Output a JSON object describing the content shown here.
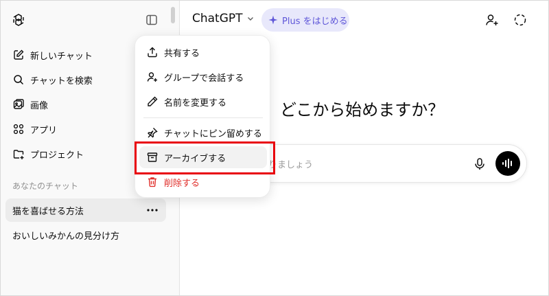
{
  "sidebar": {
    "nav": [
      {
        "label": "新しいチャット",
        "icon": "new-chat-icon"
      },
      {
        "label": "チャットを検索",
        "icon": "search-icon"
      },
      {
        "label": "画像",
        "icon": "images-icon"
      },
      {
        "label": "アプリ",
        "icon": "apps-icon"
      },
      {
        "label": "プロジェクト",
        "icon": "folder-plus-icon"
      }
    ],
    "section_label": "あなたのチャット",
    "chats": [
      {
        "label": "猫を喜ばせる方法",
        "active": true
      },
      {
        "label": "おいしいみかんの見分け方",
        "active": false
      }
    ]
  },
  "header": {
    "model": "ChatGPT",
    "plus_label": "Plus をはじめる",
    "accent": "#5e56d8"
  },
  "main": {
    "heading": "どこから始めますか？",
    "composer_placeholder": "りましょう"
  },
  "context_menu": {
    "items": [
      {
        "label": "共有する",
        "icon": "share-icon"
      },
      {
        "label": "グループで会話する",
        "icon": "add-people-icon"
      },
      {
        "label": "名前を変更する",
        "icon": "pencil-icon"
      },
      {
        "label": "チャットにピン留めする",
        "icon": "pin-icon"
      },
      {
        "label": "アーカイブする",
        "icon": "archive-icon",
        "highlighted": true
      },
      {
        "label": "削除する",
        "icon": "trash-icon",
        "danger": true
      }
    ],
    "danger_color": "#e02e2a",
    "highlight_color": "#e8000c"
  }
}
